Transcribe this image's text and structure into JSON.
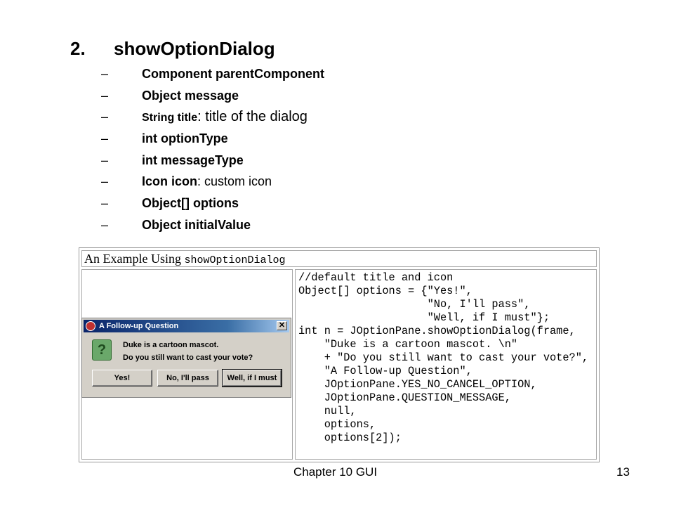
{
  "heading": {
    "number": "2.",
    "text": "showOptionDialog"
  },
  "bullets": [
    {
      "dash": "–",
      "bold": "Component parentComponent",
      "rest": ""
    },
    {
      "dash": "–",
      "bold": "Object message",
      "rest": ""
    },
    {
      "dash": "–",
      "bold": "String title",
      "rest": ": title of the dialog"
    },
    {
      "dash": "–",
      "bold": "int optionType",
      "rest": ""
    },
    {
      "dash": "–",
      "bold": "int messageType",
      "rest": ""
    },
    {
      "dash": "–",
      "bold": "Icon icon",
      "rest": ": custom icon"
    },
    {
      "dash": "–",
      "bold": "Object[] options",
      "rest": ""
    },
    {
      "dash": "–",
      "bold": "Object initialValue",
      "rest": ""
    }
  ],
  "example": {
    "title_prefix": "An Example Using ",
    "title_code": "showOptionDialog",
    "code": "//default title and icon\nObject[] options = {\"Yes!\",\n                    \"No, I'll pass\",\n                    \"Well, if I must\"};\nint n = JOptionPane.showOptionDialog(frame,\n    \"Duke is a cartoon mascot. \\n\"\n    + \"Do you still want to cast your vote?\",\n    \"A Follow-up Question\",\n    JOptionPane.YES_NO_CANCEL_OPTION,\n    JOptionPane.QUESTION_MESSAGE,\n    null,\n    options,\n    options[2]);"
  },
  "dialog": {
    "title": "A Follow-up Question",
    "close": "✕",
    "icon_glyph": "?",
    "message_line1": "Duke is a cartoon mascot.",
    "message_line2": "Do you  still want to cast your vote?",
    "buttons": [
      "Yes!",
      "No, I'll pass",
      "Well, if I must"
    ]
  },
  "footer": {
    "center": "Chapter 10 GUI",
    "page": "13"
  }
}
